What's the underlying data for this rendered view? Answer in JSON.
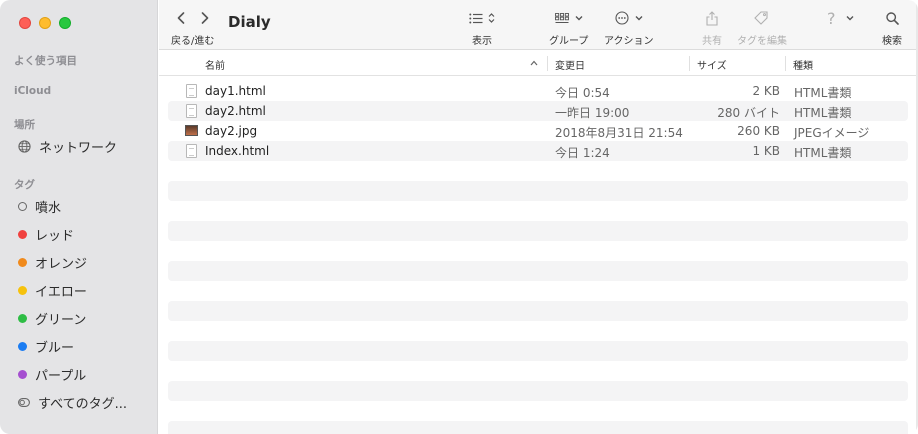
{
  "window": {
    "title": "Dialy"
  },
  "sidebar": {
    "favorites_label": "よく使う項目",
    "icloud_label": "iCloud",
    "locations_label": "場所",
    "network_label": "ネットワーク",
    "tags_label": "タグ",
    "tags": [
      {
        "label": "噴水",
        "color": ""
      },
      {
        "label": "レッド",
        "color": "#f0413f"
      },
      {
        "label": "オレンジ",
        "color": "#f08a1c"
      },
      {
        "label": "イエロー",
        "color": "#f6c20d"
      },
      {
        "label": "グリーン",
        "color": "#2ebd45"
      },
      {
        "label": "ブルー",
        "color": "#1b7cf2"
      },
      {
        "label": "パープル",
        "color": "#a54fd0"
      }
    ],
    "all_tags_label": "すべてのタグ..."
  },
  "toolbar": {
    "back_forward_label": "戻る/進む",
    "view_label": "表示",
    "group_label": "グループ",
    "action_label": "アクション",
    "share_label": "共有",
    "edit_tags_label": "タグを編集",
    "search_label": "検索"
  },
  "columns": {
    "name": "名前",
    "date": "変更日",
    "size": "サイズ",
    "kind": "種類"
  },
  "files": [
    {
      "name": "day1.html",
      "date": "今日 0:54",
      "size": "2 KB",
      "kind": "HTML書類",
      "icon": "document-icon"
    },
    {
      "name": "day2.html",
      "date": "一昨日 19:00",
      "size": "280 バイト",
      "kind": "HTML書類",
      "icon": "document-icon"
    },
    {
      "name": "day2.jpg",
      "date": "2018年8月31日 21:54",
      "size": "260 KB",
      "kind": "JPEGイメージ",
      "icon": "image-icon"
    },
    {
      "name": "Index.html",
      "date": "今日 1:24",
      "size": "1 KB",
      "kind": "HTML書類",
      "icon": "document-icon"
    }
  ]
}
